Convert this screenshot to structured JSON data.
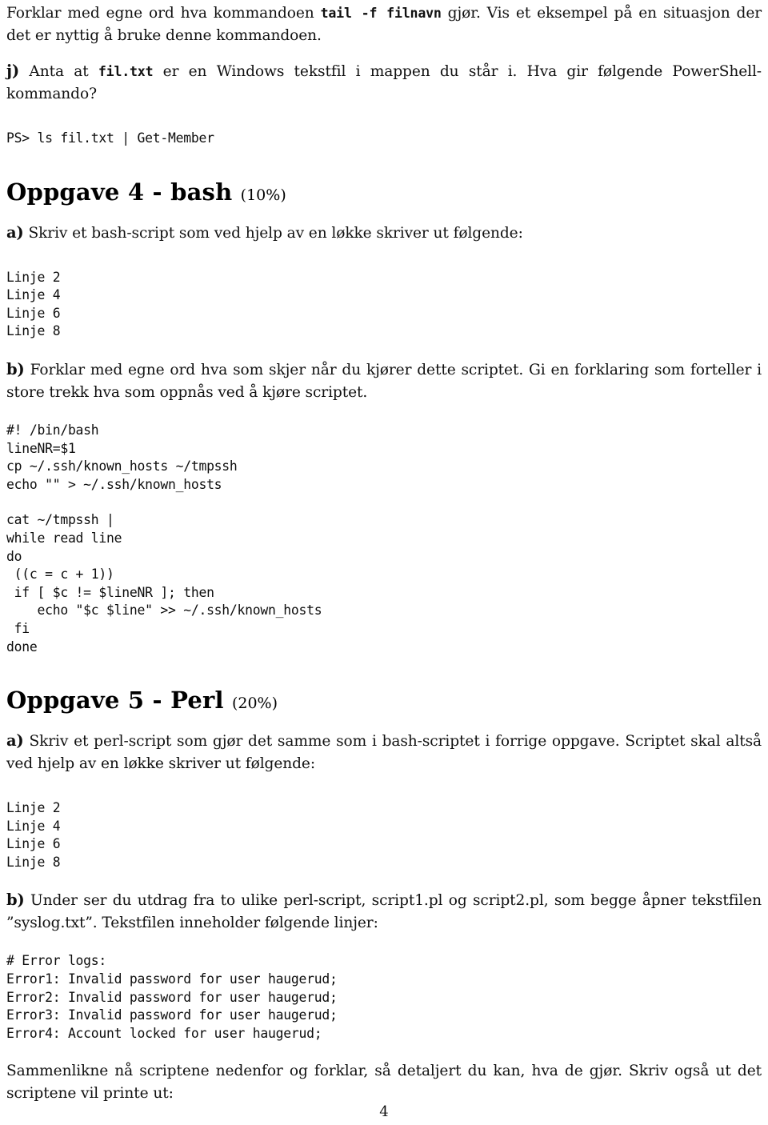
{
  "document": {
    "page_number": "4",
    "language": "no"
  },
  "intro": {
    "para_i": {
      "before": "Forklar med egne ord hva kommandoen ",
      "code": "tail -f filnavn",
      "after": " gjør. Vis et eksempel på en situasjon der det er nyttig å bruke denne kommandoen."
    },
    "item_j": {
      "label": "j)",
      "before": "Anta at ",
      "code": "fil.txt",
      "after": " er en Windows tekstfil i mappen du står i. Hva gir følgende PowerShell-kommando?"
    },
    "powershell_code": "PS> ls fil.txt | Get-Member"
  },
  "oppgave4": {
    "heading_title": "Oppgave 4 - bash",
    "heading_percent": "(10%)",
    "item_a": {
      "label": "a)",
      "text": "Skriv et bash-script som ved hjelp av en løkke skriver ut følgende:"
    },
    "output_a": "Linje 2\nLinje 4\nLinje 6\nLinje 8",
    "item_b": {
      "label": "b)",
      "text": "Forklar med egne ord hva som skjer når du kjører dette scriptet. Gi en forklaring som forteller i store trekk hva som oppnås ved å kjøre scriptet."
    },
    "script_part1": "#! /bin/bash\nlineNR=$1\ncp ~/.ssh/known_hosts ~/tmpssh\necho \"\" > ~/.ssh/known_hosts",
    "script_part2": "cat ~/tmpssh |\nwhile read line\ndo\n ((c = c + 1))\n if [ $c != $lineNR ]; then\n    echo \"$c $line\" >> ~/.ssh/known_hosts\n fi\ndone"
  },
  "oppgave5": {
    "heading_title": "Oppgave 5 - Perl",
    "heading_percent": "(20%)",
    "item_a": {
      "label": "a)",
      "text": "Skriv et perl-script som gjør det samme som i bash-scriptet i forrige oppgave. Scriptet skal altså ved hjelp av en løkke skriver ut følgende:"
    },
    "output_a": "Linje 2\nLinje 4\nLinje 6\nLinje 8",
    "item_b": {
      "label": "b)",
      "text": "Under ser du utdrag fra to ulike perl-script, script1.pl og script2.pl, som begge åpner tekstfilen ”syslog.txt”. Tekstfilen inneholder følgende linjer:"
    },
    "syslog_content": "# Error logs:\nError1: Invalid password for user haugerud;\nError2: Invalid password for user haugerud;\nError3: Invalid password for user haugerud;\nError4: Account locked for user haugerud;",
    "closing_text": "Sammenlikne nå scriptene nedenfor og forklar, så detaljert du kan, hva de gjør. Skriv også ut det scriptene vil printe ut:"
  }
}
